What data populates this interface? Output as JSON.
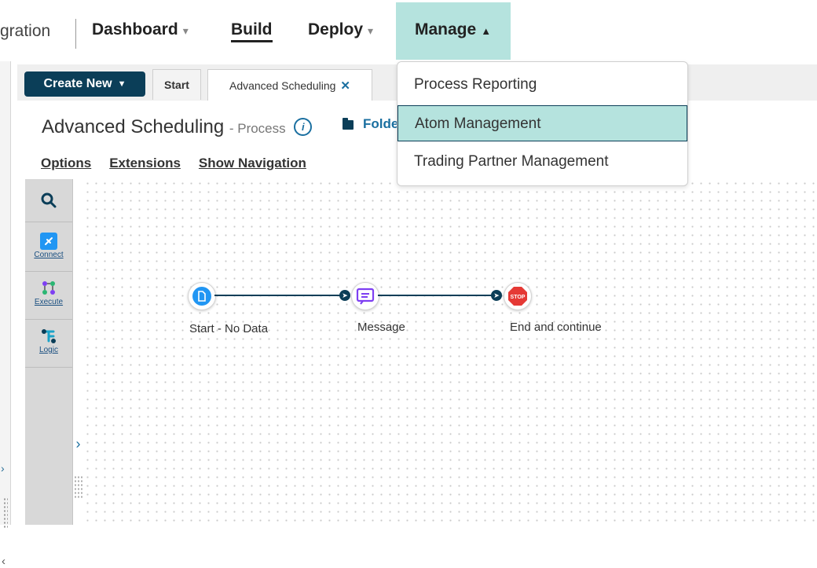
{
  "nav": {
    "fragment": "gration",
    "items": [
      {
        "label": "Dashboard",
        "has_caret": true
      },
      {
        "label": "Build",
        "has_caret": false
      },
      {
        "label": "Deploy",
        "has_caret": true
      },
      {
        "label": "Manage",
        "has_caret": true
      }
    ],
    "active": "Manage",
    "manage_dropdown": [
      "Process Reporting",
      "Atom Management",
      "Trading Partner Management"
    ],
    "hovered_item": "Atom Management"
  },
  "toolbar": {
    "create_new_label": "Create New",
    "tabs": [
      {
        "label": "Start"
      },
      {
        "label": "Advanced Scheduling",
        "closable": true
      }
    ]
  },
  "process": {
    "title": "Advanced Scheduling",
    "subtitle": "- Process",
    "info_icon": "i",
    "folder_label": "Folde",
    "links": [
      "Options",
      "Extensions",
      "Show Navigation"
    ]
  },
  "palette": {
    "items": [
      {
        "icon": "search-icon",
        "label": ""
      },
      {
        "icon": "connect-icon",
        "label": "Connect"
      },
      {
        "icon": "execute-icon",
        "label": "Execute"
      },
      {
        "icon": "logic-icon",
        "label": "Logic"
      }
    ]
  },
  "canvas": {
    "shapes": [
      {
        "label": "Start - No Data",
        "icon": "start-doc-icon"
      },
      {
        "label": "Message",
        "icon": "message-icon"
      },
      {
        "label": "End and continue",
        "icon": "stop-icon",
        "icon_text": "STOP"
      }
    ]
  },
  "colors": {
    "accent": "#0b3e58",
    "highlight": "#b5e3de",
    "link": "#1a6fa0",
    "stop": "#e53935",
    "start": "#2196f3",
    "message": "#7e3ff2"
  }
}
